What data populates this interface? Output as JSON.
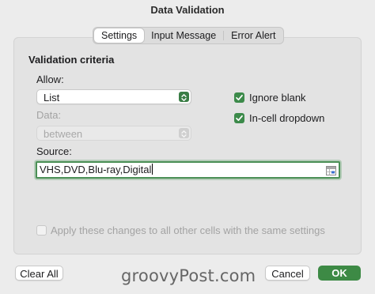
{
  "window": {
    "title": "Data Validation"
  },
  "tabs": [
    {
      "label": "Settings",
      "active": true
    },
    {
      "label": "Input Message",
      "active": false
    },
    {
      "label": "Error Alert",
      "active": false
    }
  ],
  "settings": {
    "section_title": "Validation criteria",
    "allow": {
      "label": "Allow:",
      "value": "List"
    },
    "data": {
      "label": "Data:",
      "value": "between",
      "disabled": true
    },
    "source": {
      "label": "Source:",
      "value": "VHS,DVD,Blu-ray,Digital"
    },
    "ignore_blank": {
      "label": "Ignore blank",
      "checked": true
    },
    "in_cell_dropdown": {
      "label": "In-cell dropdown",
      "checked": true
    },
    "apply_all": {
      "label": "Apply these changes to all other cells with the same settings",
      "checked": false,
      "disabled": true
    }
  },
  "buttons": {
    "clear_all": "Clear All",
    "cancel": "Cancel",
    "ok": "OK"
  },
  "watermark": "groovyPost.com",
  "colors": {
    "accent": "#3d8a45",
    "background": "#ececec"
  }
}
